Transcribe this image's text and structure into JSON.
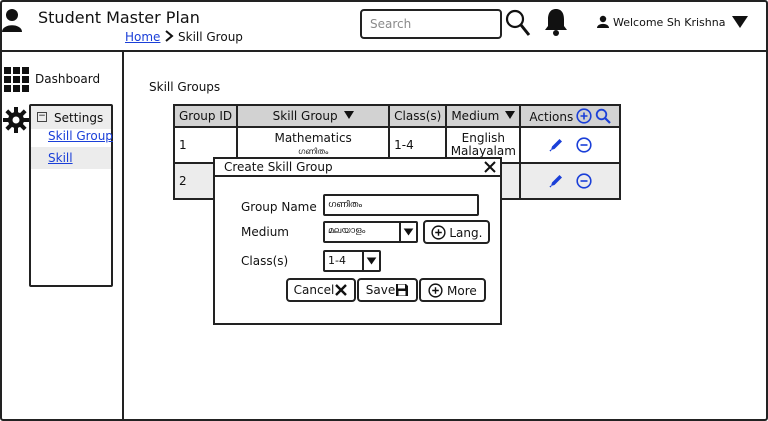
{
  "app": {
    "title": "Student Master Plan",
    "welcome": "Welcome Sh Krishna"
  },
  "breadcrumb": {
    "home": "Home",
    "current": "Skill Group"
  },
  "search": {
    "placeholder": "Search"
  },
  "sidebar": {
    "dashboard_label": "Dashboard",
    "settings_label": "Settings",
    "links": [
      {
        "label": "Skill Group"
      },
      {
        "label": "Skill"
      }
    ]
  },
  "main": {
    "title": "Skill Groups",
    "table": {
      "columns": [
        "Group ID",
        "Skill Group",
        "Class(s)",
        "Medium",
        "Actions"
      ],
      "rows": [
        {
          "id": "1",
          "skill_group": "Mathematics",
          "skill_group_sub": "ഗണിതം",
          "classes": "1-4",
          "medium": "English",
          "medium_sub": "Malayalam"
        },
        {
          "id": "2",
          "skill_group": "",
          "skill_group_sub": "",
          "classes": "",
          "medium": "",
          "medium_sub": ""
        }
      ]
    }
  },
  "dialog": {
    "title": "Create Skill Group",
    "group_name_label": "Group Name",
    "group_name_value": "ഗണിതം",
    "medium_label": "Medium",
    "medium_value": "മലയാളം",
    "lang_button": "Lang.",
    "classes_label": "Class(s)",
    "classes_value": "1-4",
    "cancel_button": "Cancel",
    "save_button": "Save",
    "more_button": "More"
  },
  "icons": {
    "user": "user-icon",
    "search": "search-icon",
    "bell": "bell-icon",
    "dropdown": "chevron-down-icon",
    "dashboard": "grid-icon",
    "settings": "gear-icon",
    "add": "plus-circle-icon",
    "edit": "pencil-icon",
    "delete": "minus-circle-icon",
    "close": "close-icon",
    "save": "floppy-icon"
  },
  "colors": {
    "link": "#1a3fd8",
    "action_icon": "#1a3fd8",
    "header_fill": "#d2d2d2",
    "alt_row": "#ececec"
  }
}
